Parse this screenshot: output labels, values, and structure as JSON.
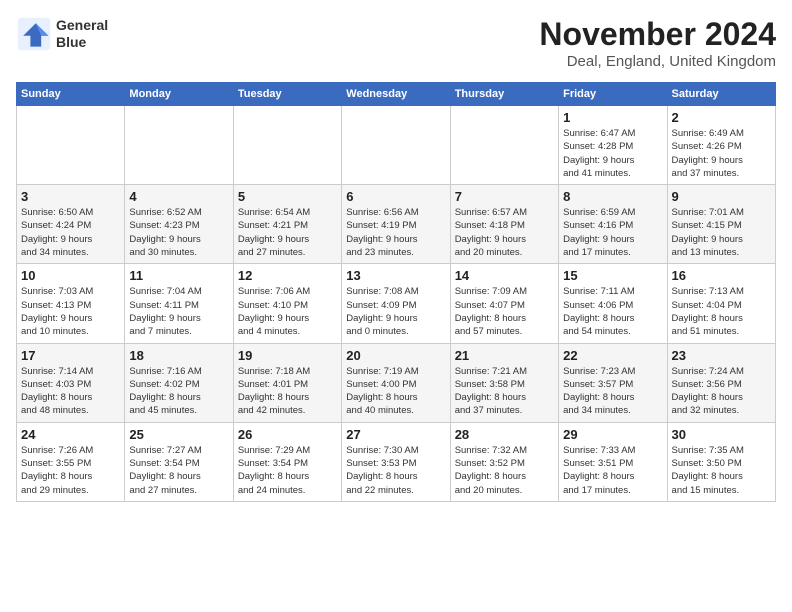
{
  "header": {
    "logo_line1": "General",
    "logo_line2": "Blue",
    "title": "November 2024",
    "subtitle": "Deal, England, United Kingdom"
  },
  "weekdays": [
    "Sunday",
    "Monday",
    "Tuesday",
    "Wednesday",
    "Thursday",
    "Friday",
    "Saturday"
  ],
  "weeks": [
    [
      {
        "day": "",
        "info": ""
      },
      {
        "day": "",
        "info": ""
      },
      {
        "day": "",
        "info": ""
      },
      {
        "day": "",
        "info": ""
      },
      {
        "day": "",
        "info": ""
      },
      {
        "day": "1",
        "info": "Sunrise: 6:47 AM\nSunset: 4:28 PM\nDaylight: 9 hours\nand 41 minutes."
      },
      {
        "day": "2",
        "info": "Sunrise: 6:49 AM\nSunset: 4:26 PM\nDaylight: 9 hours\nand 37 minutes."
      }
    ],
    [
      {
        "day": "3",
        "info": "Sunrise: 6:50 AM\nSunset: 4:24 PM\nDaylight: 9 hours\nand 34 minutes."
      },
      {
        "day": "4",
        "info": "Sunrise: 6:52 AM\nSunset: 4:23 PM\nDaylight: 9 hours\nand 30 minutes."
      },
      {
        "day": "5",
        "info": "Sunrise: 6:54 AM\nSunset: 4:21 PM\nDaylight: 9 hours\nand 27 minutes."
      },
      {
        "day": "6",
        "info": "Sunrise: 6:56 AM\nSunset: 4:19 PM\nDaylight: 9 hours\nand 23 minutes."
      },
      {
        "day": "7",
        "info": "Sunrise: 6:57 AM\nSunset: 4:18 PM\nDaylight: 9 hours\nand 20 minutes."
      },
      {
        "day": "8",
        "info": "Sunrise: 6:59 AM\nSunset: 4:16 PM\nDaylight: 9 hours\nand 17 minutes."
      },
      {
        "day": "9",
        "info": "Sunrise: 7:01 AM\nSunset: 4:15 PM\nDaylight: 9 hours\nand 13 minutes."
      }
    ],
    [
      {
        "day": "10",
        "info": "Sunrise: 7:03 AM\nSunset: 4:13 PM\nDaylight: 9 hours\nand 10 minutes."
      },
      {
        "day": "11",
        "info": "Sunrise: 7:04 AM\nSunset: 4:11 PM\nDaylight: 9 hours\nand 7 minutes."
      },
      {
        "day": "12",
        "info": "Sunrise: 7:06 AM\nSunset: 4:10 PM\nDaylight: 9 hours\nand 4 minutes."
      },
      {
        "day": "13",
        "info": "Sunrise: 7:08 AM\nSunset: 4:09 PM\nDaylight: 9 hours\nand 0 minutes."
      },
      {
        "day": "14",
        "info": "Sunrise: 7:09 AM\nSunset: 4:07 PM\nDaylight: 8 hours\nand 57 minutes."
      },
      {
        "day": "15",
        "info": "Sunrise: 7:11 AM\nSunset: 4:06 PM\nDaylight: 8 hours\nand 54 minutes."
      },
      {
        "day": "16",
        "info": "Sunrise: 7:13 AM\nSunset: 4:04 PM\nDaylight: 8 hours\nand 51 minutes."
      }
    ],
    [
      {
        "day": "17",
        "info": "Sunrise: 7:14 AM\nSunset: 4:03 PM\nDaylight: 8 hours\nand 48 minutes."
      },
      {
        "day": "18",
        "info": "Sunrise: 7:16 AM\nSunset: 4:02 PM\nDaylight: 8 hours\nand 45 minutes."
      },
      {
        "day": "19",
        "info": "Sunrise: 7:18 AM\nSunset: 4:01 PM\nDaylight: 8 hours\nand 42 minutes."
      },
      {
        "day": "20",
        "info": "Sunrise: 7:19 AM\nSunset: 4:00 PM\nDaylight: 8 hours\nand 40 minutes."
      },
      {
        "day": "21",
        "info": "Sunrise: 7:21 AM\nSunset: 3:58 PM\nDaylight: 8 hours\nand 37 minutes."
      },
      {
        "day": "22",
        "info": "Sunrise: 7:23 AM\nSunset: 3:57 PM\nDaylight: 8 hours\nand 34 minutes."
      },
      {
        "day": "23",
        "info": "Sunrise: 7:24 AM\nSunset: 3:56 PM\nDaylight: 8 hours\nand 32 minutes."
      }
    ],
    [
      {
        "day": "24",
        "info": "Sunrise: 7:26 AM\nSunset: 3:55 PM\nDaylight: 8 hours\nand 29 minutes."
      },
      {
        "day": "25",
        "info": "Sunrise: 7:27 AM\nSunset: 3:54 PM\nDaylight: 8 hours\nand 27 minutes."
      },
      {
        "day": "26",
        "info": "Sunrise: 7:29 AM\nSunset: 3:54 PM\nDaylight: 8 hours\nand 24 minutes."
      },
      {
        "day": "27",
        "info": "Sunrise: 7:30 AM\nSunset: 3:53 PM\nDaylight: 8 hours\nand 22 minutes."
      },
      {
        "day": "28",
        "info": "Sunrise: 7:32 AM\nSunset: 3:52 PM\nDaylight: 8 hours\nand 20 minutes."
      },
      {
        "day": "29",
        "info": "Sunrise: 7:33 AM\nSunset: 3:51 PM\nDaylight: 8 hours\nand 17 minutes."
      },
      {
        "day": "30",
        "info": "Sunrise: 7:35 AM\nSunset: 3:50 PM\nDaylight: 8 hours\nand 15 minutes."
      }
    ]
  ]
}
